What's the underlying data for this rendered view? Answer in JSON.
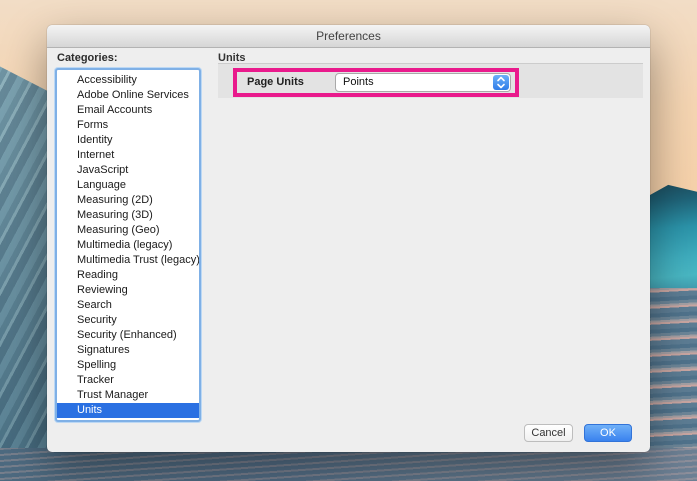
{
  "window": {
    "title": "Preferences",
    "categories_label": "Categories:",
    "section": {
      "header": "Units",
      "row_label": "Page Units",
      "select_value": "Points"
    },
    "buttons": {
      "cancel": "Cancel",
      "ok": "OK"
    }
  },
  "sidebar": {
    "items": [
      {
        "label": "Accessibility",
        "selected": false
      },
      {
        "label": "Adobe Online Services",
        "selected": false
      },
      {
        "label": "Email Accounts",
        "selected": false
      },
      {
        "label": "Forms",
        "selected": false
      },
      {
        "label": "Identity",
        "selected": false
      },
      {
        "label": "Internet",
        "selected": false
      },
      {
        "label": "JavaScript",
        "selected": false
      },
      {
        "label": "Language",
        "selected": false
      },
      {
        "label": "Measuring (2D)",
        "selected": false
      },
      {
        "label": "Measuring (3D)",
        "selected": false
      },
      {
        "label": "Measuring (Geo)",
        "selected": false
      },
      {
        "label": "Multimedia (legacy)",
        "selected": false
      },
      {
        "label": "Multimedia Trust (legacy)",
        "selected": false
      },
      {
        "label": "Reading",
        "selected": false
      },
      {
        "label": "Reviewing",
        "selected": false
      },
      {
        "label": "Search",
        "selected": false
      },
      {
        "label": "Security",
        "selected": false
      },
      {
        "label": "Security (Enhanced)",
        "selected": false
      },
      {
        "label": "Signatures",
        "selected": false
      },
      {
        "label": "Spelling",
        "selected": false
      },
      {
        "label": "Tracker",
        "selected": false
      },
      {
        "label": "Trust Manager",
        "selected": false
      },
      {
        "label": "Units",
        "selected": true
      }
    ]
  },
  "colors": {
    "annotation_highlight": "#e91a8c",
    "selection_blue": "#2a70e2",
    "stepper_blue_top": "#6db1f9",
    "stepper_blue_bottom": "#2f7ce8",
    "ok_button_blue": "#3a82ee"
  },
  "icons": {
    "select_stepper": "up-down-chevrons-icon"
  }
}
